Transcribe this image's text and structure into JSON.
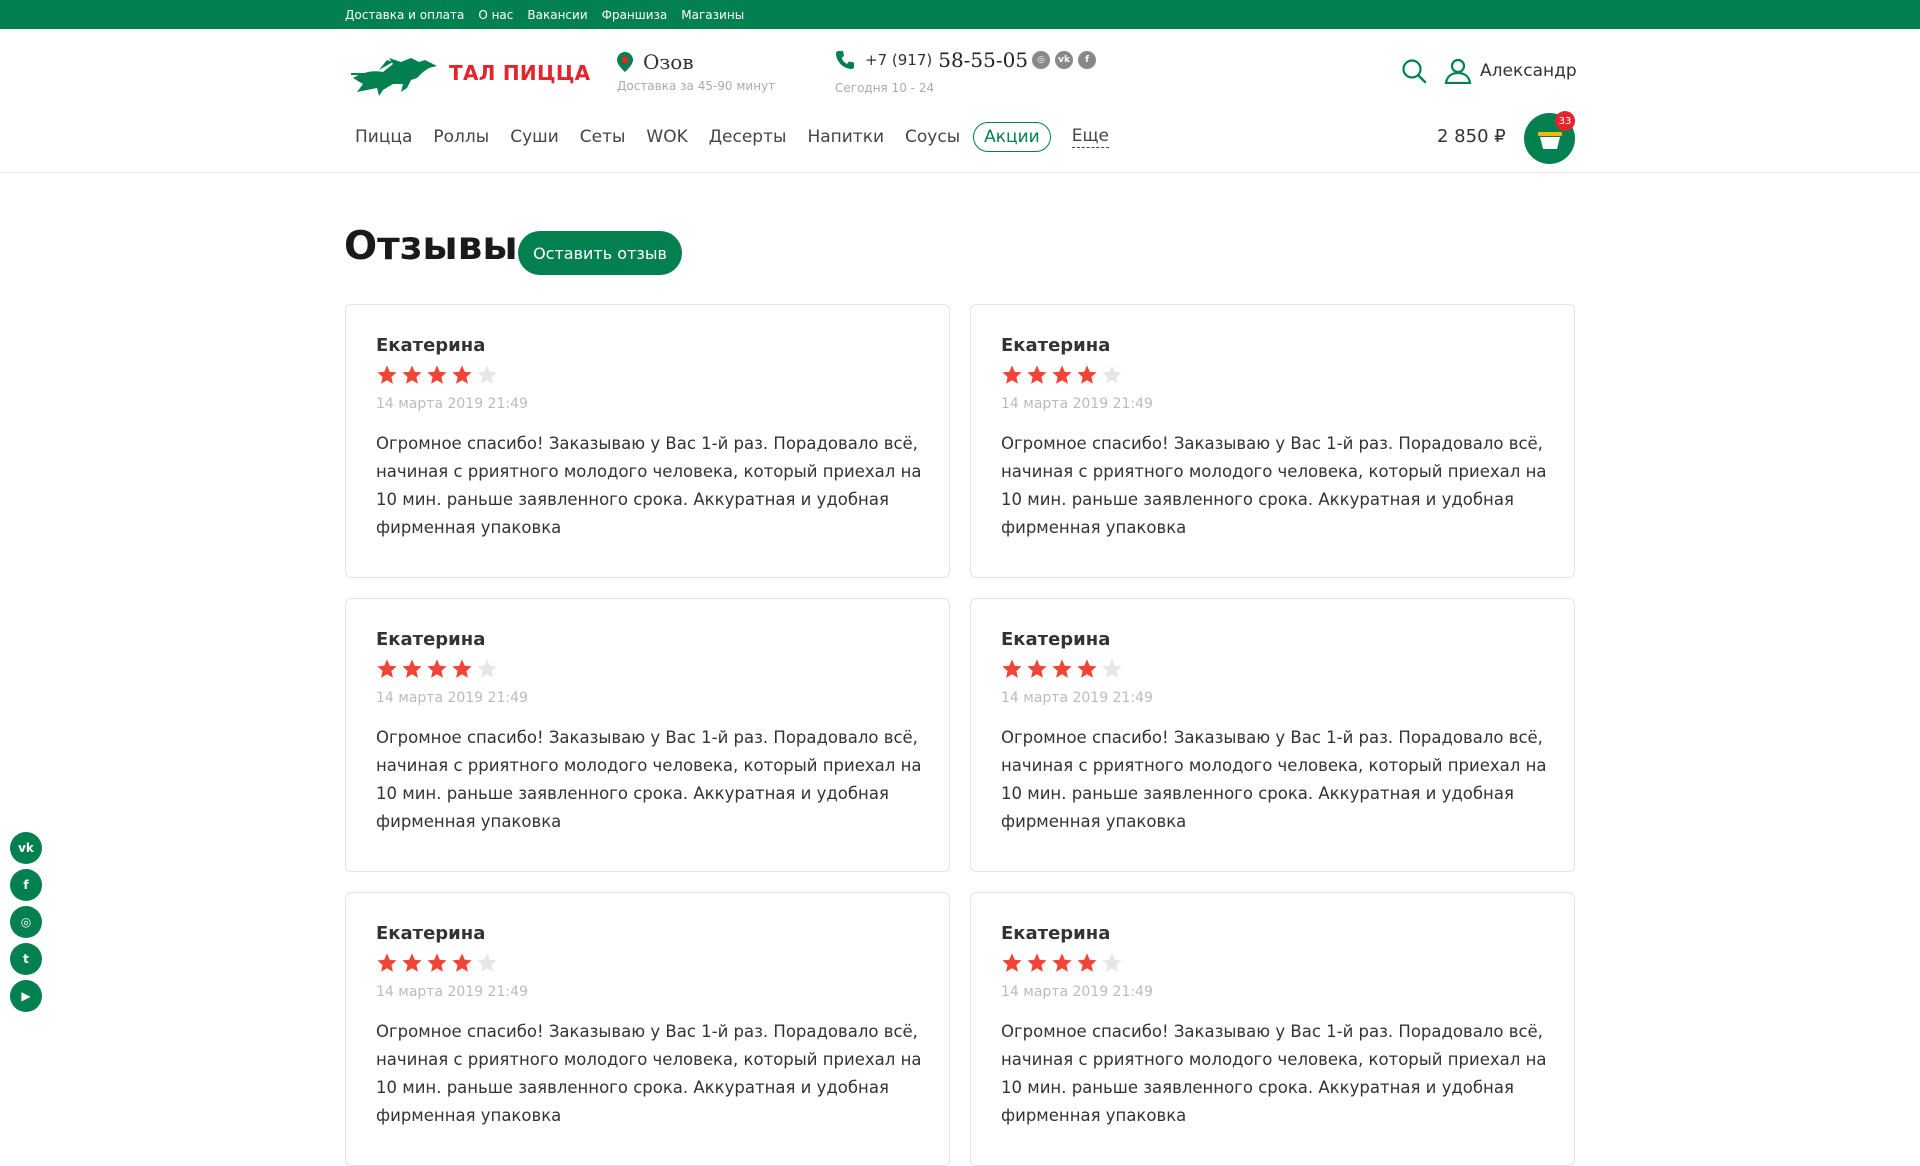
{
  "topbar": {
    "links": [
      "Доставка и оплата",
      "О нас",
      "Вакансии",
      "Франшиза",
      "Магазины"
    ]
  },
  "header": {
    "logo_text": "ТАЛ ПИЦЦА",
    "city": "Озов",
    "delivery_time": "Доставка за 45-90 минут",
    "phone_prefix": "+7 (917)",
    "phone_number": "58-55-05",
    "hours": "Сегодня 10 - 24",
    "user_name": "Александр",
    "cart_total": "2 850 ₽",
    "cart_count": "33"
  },
  "nav": {
    "items": [
      "Пицца",
      "Роллы",
      "Суши",
      "Сеты",
      "WOK",
      "Десерты",
      "Напитки",
      "Соусы"
    ],
    "promo": "Акции",
    "more": "Еще"
  },
  "main": {
    "title": "Отзывы",
    "leave_review": "Оставить отзыв",
    "reviews": [
      {
        "name": "Екатерина",
        "rating": 4,
        "date": "14 марта 2019 21:49",
        "text": "Огромное спасибо! Заказываю у Вас 1-й раз. Порадовало всё, начиная с рриятного молодого человека, который приехал на 10 мин. раньше заявленного срока. Аккуратная и удобная фирменная упаковка"
      },
      {
        "name": "Екатерина",
        "rating": 4,
        "date": "14 марта 2019 21:49",
        "text": "Огромное спасибо! Заказываю у Вас 1-й раз. Порадовало всё, начиная с рриятного молодого человека, который приехал на 10 мин. раньше заявленного срока. Аккуратная и удобная фирменная упаковка"
      },
      {
        "name": "Екатерина",
        "rating": 4,
        "date": "14 марта 2019 21:49",
        "text": "Огромное спасибо! Заказываю у Вас 1-й раз. Порадовало всё, начиная с рриятного молодого человека, который приехал на 10 мин. раньше заявленного срока. Аккуратная и удобная фирменная упаковка"
      },
      {
        "name": "Екатерина",
        "rating": 4,
        "date": "14 марта 2019 21:49",
        "text": "Огромное спасибо! Заказываю у Вас 1-й раз. Порадовало всё, начиная с рриятного молодого человека, который приехал на 10 мин. раньше заявленного срока. Аккуратная и удобная фирменная упаковка"
      },
      {
        "name": "Екатерина",
        "rating": 4,
        "date": "14 марта 2019 21:49",
        "text": "Огромное спасибо! Заказываю у Вас 1-й раз. Порадовало всё, начиная с рриятного молодого человека, который приехал на 10 мин. раньше заявленного срока. Аккуратная и удобная фирменная упаковка"
      },
      {
        "name": "Екатерина",
        "rating": 4,
        "date": "14 марта 2019 21:49",
        "text": "Огромное спасибо! Заказываю у Вас 1-й раз. Порадовало всё, начиная с рриятного молодого человека, который приехал на 10 мин. раньше заявленного срока. Аккуратная и удобная фирменная упаковка"
      }
    ]
  },
  "social_sidebar": [
    "vk-icon",
    "facebook-icon",
    "instagram-icon",
    "twitter-icon",
    "youtube-icon"
  ],
  "colors": {
    "brand_green": "#02804f",
    "brand_red": "#e3242b",
    "star_on": "#f04437",
    "star_off": "#e6e6e6"
  }
}
